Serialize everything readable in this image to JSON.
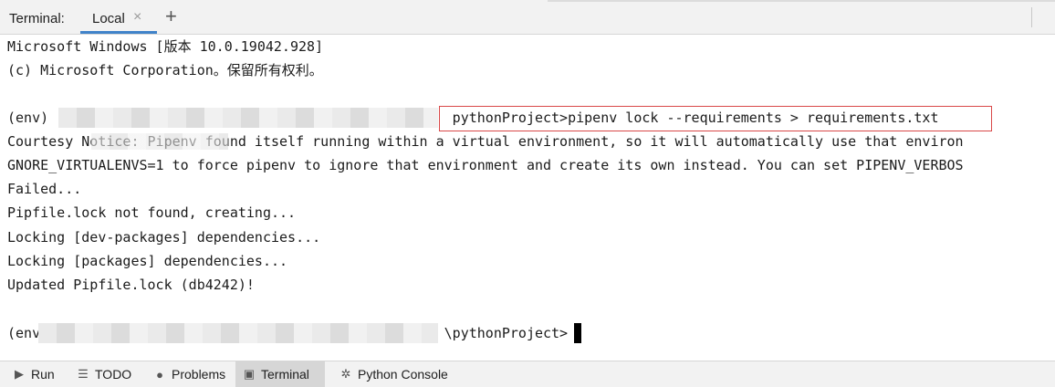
{
  "tabbar": {
    "title": "Terminal:",
    "tab_label": "Local",
    "close_glyph": "×",
    "add_glyph": "+"
  },
  "terminal": {
    "lines": [
      "Microsoft Windows [版本 10.0.19042.928]",
      "(c) Microsoft Corporation。保留所有权利。",
      "",
      "(env)                                                 pythonProject>pipenv lock --requirements > requirements.txt",
      "Courtesy Notice: Pipenv found itself running within a virtual environment, so it will automatically use that environ",
      "GNORE_VIRTUALENVS=1 to force pipenv to ignore that environment and create its own instead. You can set PIPENV_VERBOS",
      "Failed...",
      "Pipfile.lock not found, creating...",
      "Locking [dev-packages] dependencies...",
      "Locking [packages] dependencies...",
      "Updated Pipfile.lock (db4242)!",
      "",
      "(env                                                 \\pythonProject>"
    ],
    "highlighted_command": "pythonProject>pipenv lock --requirements > requirements.txt",
    "accent_color": "#d94848"
  },
  "bottombar": {
    "buttons": [
      {
        "label": "Run",
        "icon": "run-icon"
      },
      {
        "label": "TODO",
        "icon": "todo-icon"
      },
      {
        "label": "Problems",
        "icon": "problems-icon"
      },
      {
        "label": "Terminal",
        "icon": "terminal-icon",
        "active": true
      },
      {
        "label": "Python Console",
        "icon": "python-console-icon"
      }
    ]
  }
}
